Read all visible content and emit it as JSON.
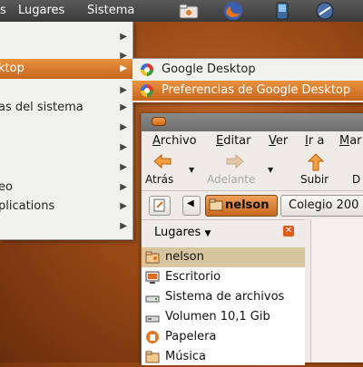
{
  "panel": {
    "menus": [
      "s",
      "Lugares",
      "Sistema"
    ],
    "launchers": [
      "folder-icon",
      "firefox-icon",
      "phone-icon",
      "network-icon"
    ]
  },
  "app_menu": {
    "items": [
      {
        "label": "",
        "has_submenu": true,
        "highlighted": false
      },
      {
        "label": "",
        "has_submenu": true,
        "highlighted": false
      },
      {
        "label": "ktop",
        "has_submenu": true,
        "highlighted": true
      },
      {
        "label": "",
        "has_submenu": true,
        "highlighted": false
      },
      {
        "label": "as del sistema",
        "has_submenu": true,
        "highlighted": false
      },
      {
        "label": "",
        "has_submenu": true,
        "highlighted": false
      },
      {
        "label": "",
        "has_submenu": true,
        "highlighted": false
      },
      {
        "label": "",
        "has_submenu": true,
        "highlighted": false
      },
      {
        "label": "eo",
        "has_submenu": true,
        "highlighted": false
      },
      {
        "label": "plications",
        "has_submenu": true,
        "highlighted": false
      },
      {
        "label": "",
        "has_submenu": true,
        "highlighted": false
      }
    ]
  },
  "submenu": {
    "items": [
      {
        "label": "Google Desktop",
        "highlighted": false
      },
      {
        "label": "Preferencias de Google Desktop",
        "highlighted": true
      }
    ]
  },
  "window": {
    "menubar": [
      {
        "u": "A",
        "rest": "rchivo"
      },
      {
        "u": "E",
        "rest": "ditar"
      },
      {
        "u": "V",
        "rest": "er"
      },
      {
        "u": "I",
        "rest": "r a"
      },
      {
        "u": "M",
        "rest": "ar"
      }
    ],
    "toolbar": {
      "back": "Atrás",
      "forward": "Adelante",
      "up": "Subir",
      "extra": "D"
    },
    "location": {
      "current": "nelson",
      "next": "Colegio 200"
    },
    "sidebar": {
      "header": "Lugares",
      "places": [
        {
          "label": "nelson",
          "icon": "home-folder-icon",
          "selected": true
        },
        {
          "label": "Escritorio",
          "icon": "desktop-icon",
          "selected": false
        },
        {
          "label": "Sistema de archivos",
          "icon": "drive-icon",
          "selected": false
        },
        {
          "label": "Volumen 10,1 Gib",
          "icon": "volume-icon",
          "selected": false
        },
        {
          "label": "Papelera",
          "icon": "trash-icon",
          "selected": false
        },
        {
          "label": "Música",
          "icon": "music-folder-icon",
          "selected": false
        }
      ]
    }
  },
  "colors": {
    "accent": "#d8772a",
    "selection": "#d8c49e"
  }
}
